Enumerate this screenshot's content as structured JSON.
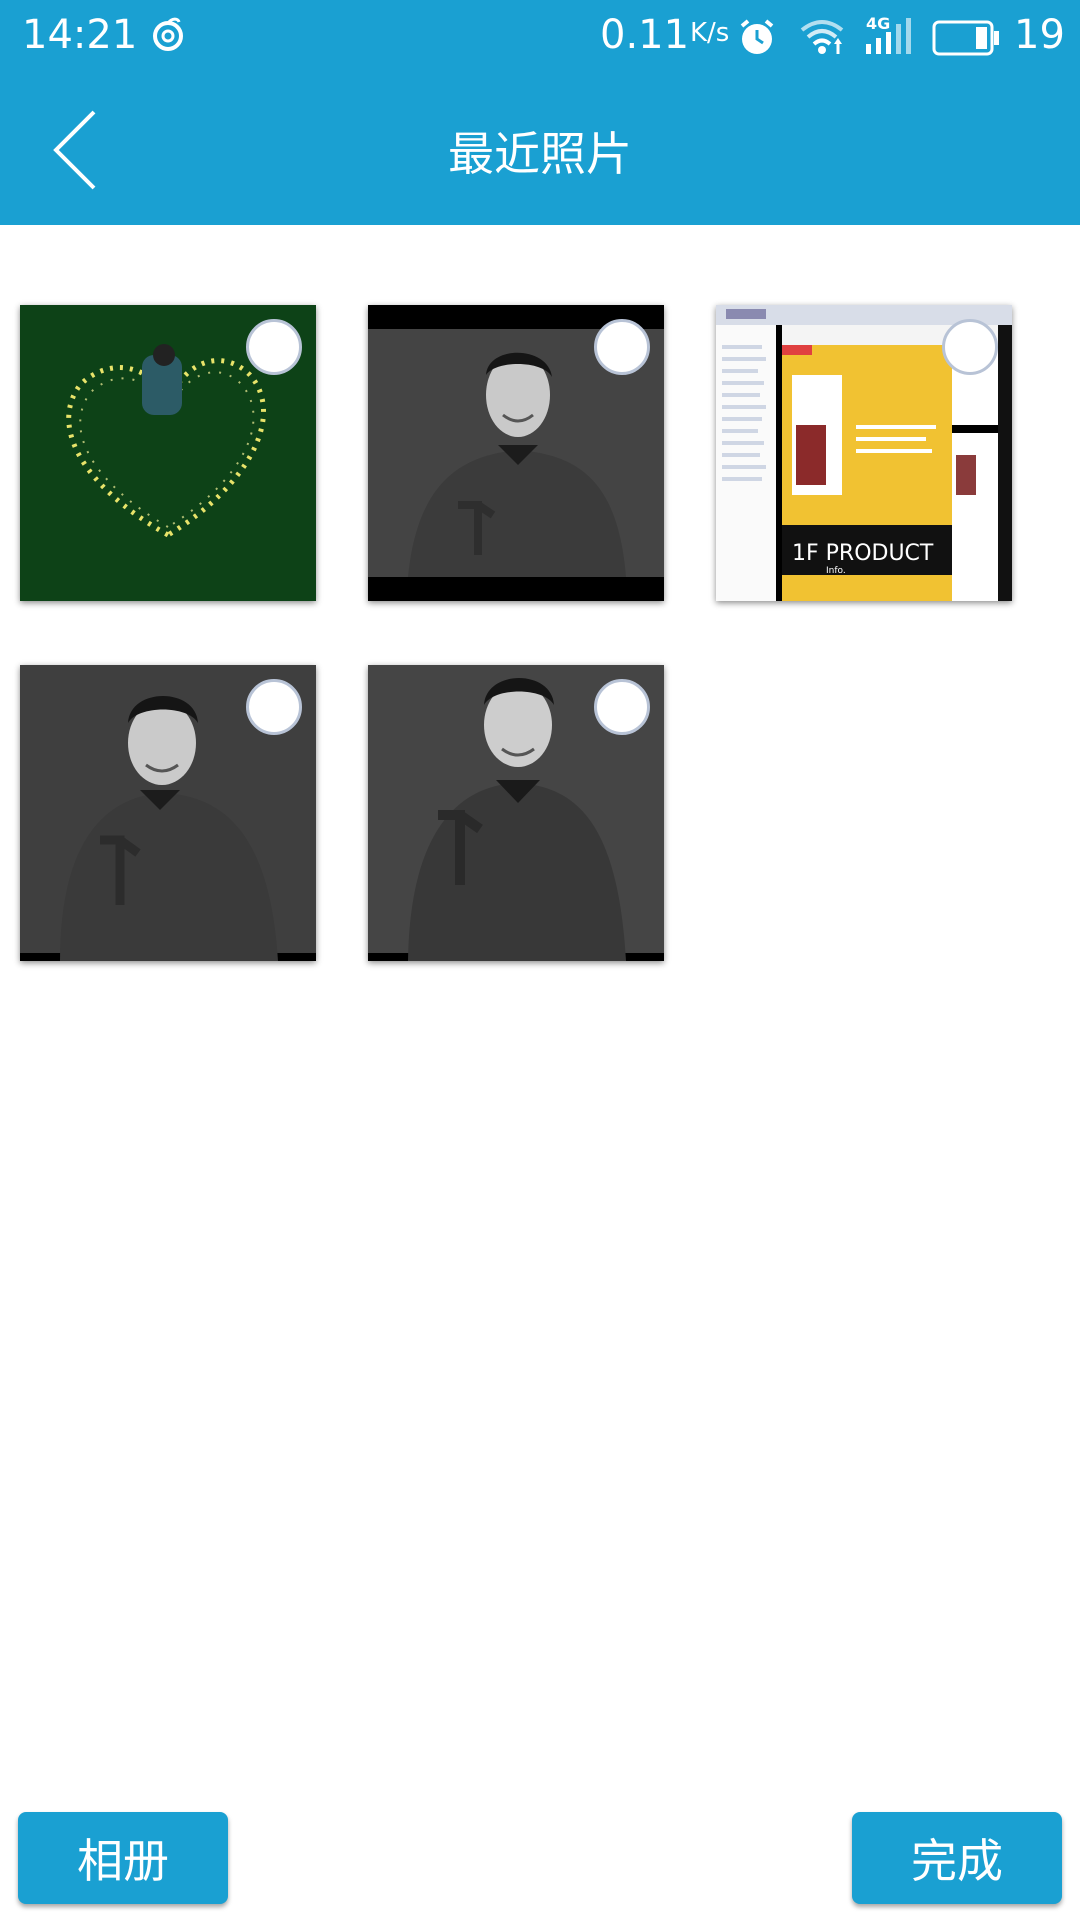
{
  "status_bar": {
    "time": "14:21",
    "app_icon": "netease-music-icon",
    "net_speed": "0.11",
    "net_speed_unit": "K/s",
    "alarm_icon": "alarm-icon",
    "wifi_icon": "wifi-icon",
    "network_type": "4G",
    "signal_icon": "signal-icon",
    "battery_icon": "battery-icon",
    "battery_percent": "19"
  },
  "header": {
    "back_icon": "back-chevron-icon",
    "title": "最近照片",
    "background_color": "#1aa0d2"
  },
  "photos": [
    {
      "subject": "heart-of-lights-photo",
      "selected": false
    },
    {
      "subject": "man-portrait-photo",
      "selected": false
    },
    {
      "subject": "webpage-screenshot-photo",
      "selected": false,
      "text_line1": "1F PRODUCT",
      "text_line2": "Info."
    },
    {
      "subject": "man-portrait-photo",
      "selected": false
    },
    {
      "subject": "man-portrait-photo",
      "selected": false
    }
  ],
  "footer": {
    "album_label": "相册",
    "done_label": "完成"
  }
}
